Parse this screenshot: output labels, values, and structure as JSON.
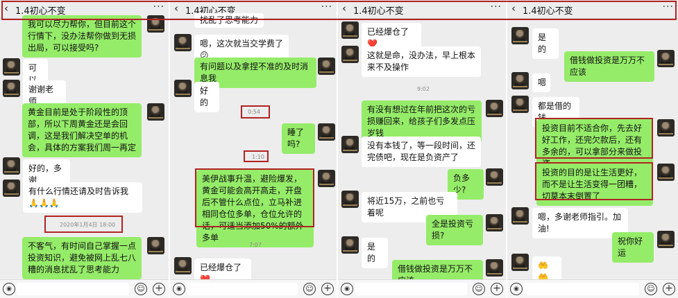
{
  "panels": [
    {
      "title": "1.4初心不变",
      "messages": [
        {
          "text": "我可以尽力帮你，但目前这个行情下，没办法帮你做到无损出局，可以接受吗?"
        },
        {
          "text": "可以"
        },
        {
          "text": "谢谢老师"
        },
        {
          "text": "黄金目前是处于阶段性的顶部，所以下周黄金还是会回调，这是我们解决空单的机会，具体的方案我们周一再定"
        },
        {
          "text": "好的，多谢"
        },
        {
          "text": "有什么行情还请及时告诉我🙏🙏🙏"
        },
        {
          "text": "不客气，有时间自己掌握一点投资知识，避免被网上乱七八糟的消息扰乱了思考能力"
        }
      ],
      "timestamps": [
        "2020年1月4日 18:00"
      ]
    },
    {
      "title": "1.4初心不变",
      "messages": [
        {
          "text": "扰乱了思考能力"
        },
        {
          "text": "嗯，这次就当交学费了😕"
        },
        {
          "text": "有问题以及拿捏不准的及时消息我"
        },
        {
          "text": "好的"
        },
        {
          "text": "睡了吗?"
        },
        {
          "text": "美伊战事升温，避险爆发，黄金可能会高开高走，开盘后不管什么点位，立马补进相同仓位多单，仓位允许的话，可适当添加50%的额外多单"
        },
        {
          "text": "已经爆仓了❤️"
        }
      ],
      "timestamps": [
        "0:54",
        "1:10",
        "7:07"
      ]
    },
    {
      "title": "1.4初心不变",
      "messages": [
        {
          "text": "已经爆仓了❤️"
        },
        {
          "text": "这就是命，没办法，早上根本来不及操作"
        },
        {
          "text": "有没有想过在年前把这次的亏损赚回来，给孩子们多发点压岁钱"
        },
        {
          "text": "没有本钱了，等一段时间，还完债吧，现在是负资产了"
        },
        {
          "text": "负多少?"
        },
        {
          "text": "将近15万，之前也亏着呢"
        },
        {
          "text": "全是投资亏损?"
        },
        {
          "text": "是的"
        },
        {
          "text": "借钱做投资是万万不应该"
        }
      ],
      "timestamps": [
        "9:02"
      ]
    },
    {
      "title": "1.4初心不变",
      "messages": [
        {
          "text": "是的"
        },
        {
          "text": "借钱做投资是万万不应该"
        },
        {
          "text": "嗯"
        },
        {
          "text": "都是借的钱"
        },
        {
          "text": "投资目前不适合你，先去好好工作，还完欠款后，还有多余的，可以拿部分来做投资"
        },
        {
          "text": "投资的目的是让生活更好，而不是让生活变得一团糟，切莫本末倒置了"
        },
        {
          "text": "嗯，多谢老师指引。加油!"
        },
        {
          "text": "祝你好运"
        },
        {
          "text": "🤲🤲"
        }
      ],
      "timestamps": []
    }
  ],
  "icons": {
    "back": "chevron-left-icon",
    "more": "more-icon",
    "voice": "voice-icon",
    "emoji": "emoji-icon",
    "plus": "plus-icon"
  },
  "colors": {
    "outgoing_bubble": "#95ec69",
    "incoming_bubble": "#ffffff",
    "background": "#ededed",
    "highlight_box": "#b22222"
  }
}
